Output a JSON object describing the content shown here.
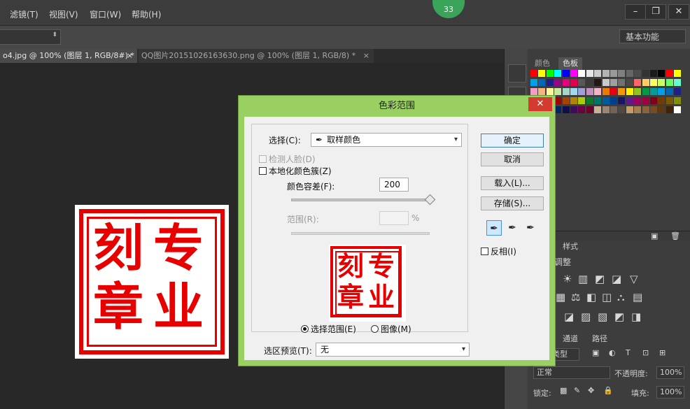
{
  "menubar": {
    "items": [
      "滤镜(T)",
      "视图(V)",
      "窗口(W)",
      "帮助(H)"
    ],
    "badge": "33",
    "window_buttons": [
      "–",
      "❐",
      "✕"
    ]
  },
  "options": {
    "workspace": "基本功能"
  },
  "tabs": [
    {
      "label": "o4.jpg @ 100% (图层 1, RGB/8#) *",
      "close": "×"
    },
    {
      "label": "QQ图片20151026163630.png @ 100% (图层 1, RGB/8) *",
      "close": "×"
    }
  ],
  "canvas": {
    "chars": [
      "刻",
      "专",
      "章",
      "业"
    ]
  },
  "panels": {
    "swatches": {
      "tab_color": "颜色",
      "tab_swatches": "色板"
    },
    "styles": {
      "tab": "样式",
      "heading": "调整"
    },
    "layers": {
      "tab_channels": "通道",
      "tab_paths": "路径",
      "kind": "类型",
      "blend": "正常",
      "opacity_label": "不透明度:",
      "opacity_value": "100%",
      "lock_label": "锁定:",
      "fill_label": "填充:",
      "fill_value": "100%"
    }
  },
  "dialog": {
    "title": "色彩范围",
    "close": "✕",
    "select_label": "选择(C):",
    "select_value": "取样颜色",
    "detect_faces": "检测人脸(D)",
    "localized_clusters": "本地化颜色簇(Z)",
    "fuzziness_label": "颜色容差(F):",
    "fuzziness_value": "200",
    "range_label": "范围(R):",
    "range_unit": "%",
    "mode_selection": "选择范围(E)",
    "mode_image": "图像(M)",
    "preview_label": "选区预览(T):",
    "preview_value": "无",
    "ok": "确定",
    "cancel": "取消",
    "load": "载入(L)...",
    "save": "存储(S)...",
    "invert": "反相(I)",
    "fuzziness_slider_fraction": 1.0
  },
  "colors": {
    "accent_red": "#e60000",
    "dialog_border": "#9ad061"
  }
}
